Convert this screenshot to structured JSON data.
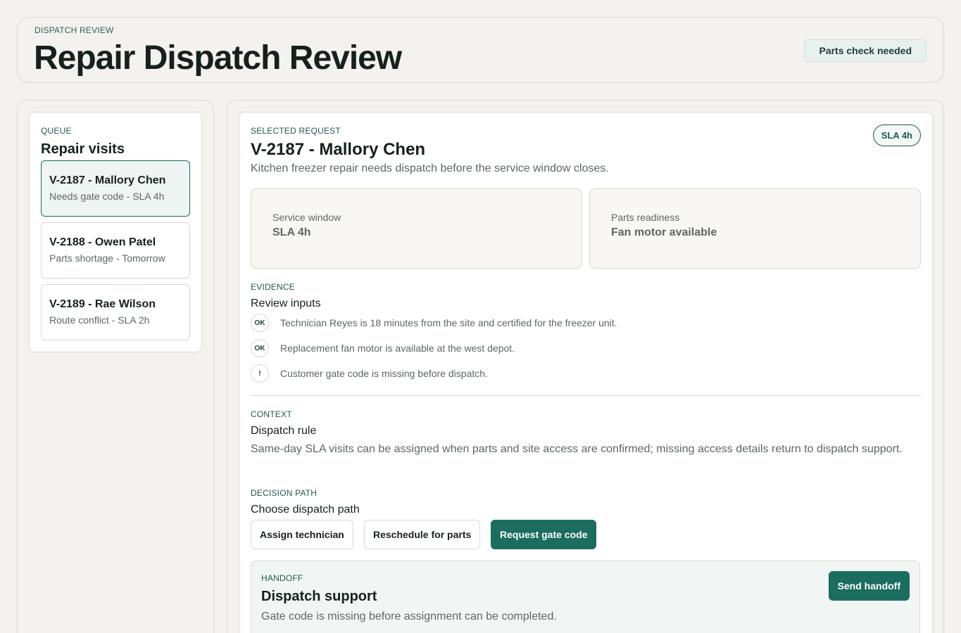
{
  "header": {
    "eyebrow": "DISPATCH REVIEW",
    "title": "Repair Dispatch Review",
    "status_badge": "Parts check needed"
  },
  "queue": {
    "eyebrow": "QUEUE",
    "title": "Repair visits",
    "items": [
      {
        "title": "V-2187 - Mallory Chen",
        "subtitle": "Needs gate code - SLA 4h",
        "selected": true
      },
      {
        "title": "V-2188 - Owen Patel",
        "subtitle": "Parts shortage - Tomorrow",
        "selected": false
      },
      {
        "title": "V-2189 - Rae Wilson",
        "subtitle": "Route conflict - SLA 2h",
        "selected": false
      }
    ]
  },
  "request": {
    "eyebrow": "SELECTED REQUEST",
    "sla_badge": "SLA 4h",
    "title": "V-2187 - Mallory Chen",
    "description": "Kitchen freezer repair needs dispatch before the service window closes.",
    "service_window": {
      "label": "Service window",
      "value": "SLA 4h"
    },
    "parts_readiness": {
      "label": "Parts readiness",
      "value": "Fan motor available"
    }
  },
  "evidence": {
    "eyebrow": "EVIDENCE",
    "title": "Review inputs",
    "items": [
      {
        "icon": "OK",
        "text": "Technician Reyes is 18 minutes from the site and certified for the freezer unit."
      },
      {
        "icon": "OK",
        "text": "Replacement fan motor is available at the west depot."
      },
      {
        "icon": "!",
        "text": "Customer gate code is missing before dispatch."
      }
    ]
  },
  "context": {
    "eyebrow": "CONTEXT",
    "title": "Dispatch rule",
    "text": "Same-day SLA visits can be assigned when parts and site access are confirmed; missing access details return to dispatch support."
  },
  "decision": {
    "eyebrow": "DECISION PATH",
    "title": "Choose dispatch path",
    "options": [
      "Assign technician",
      "Reschedule for parts",
      "Request gate code"
    ],
    "selected": "Request gate code"
  },
  "handoff": {
    "eyebrow": "HANDOFF",
    "title": "Dispatch support",
    "description": "Gate code is missing before assignment can be completed.",
    "button": "Send handoff"
  },
  "colors": {
    "accent": "#1a6d5f",
    "background": "#f3f2ee",
    "text": "#16211e",
    "muted": "#5d6764"
  }
}
